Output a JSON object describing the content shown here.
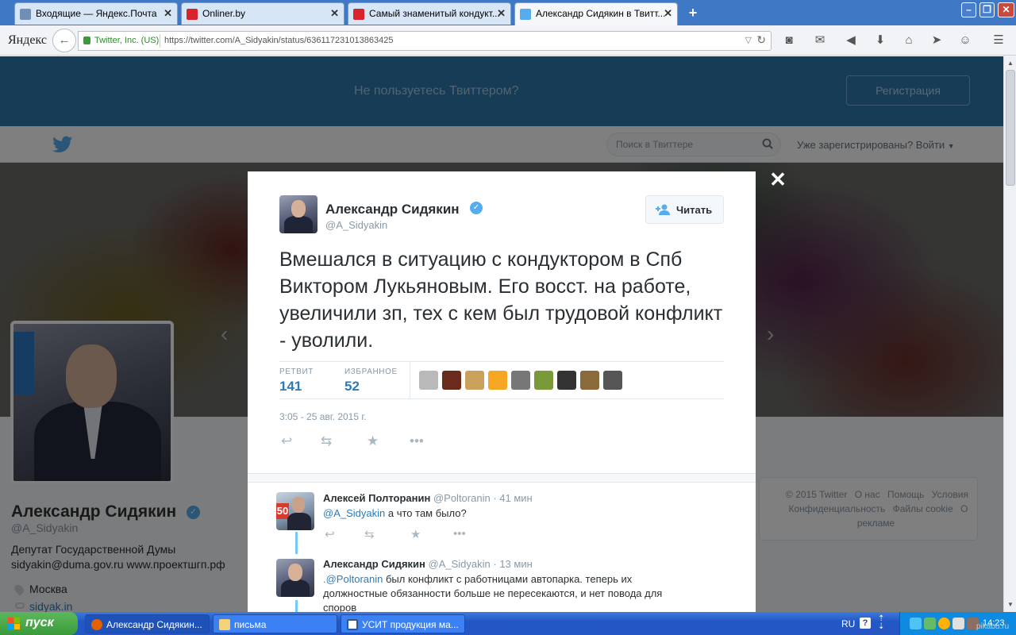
{
  "browser": {
    "tabs": [
      {
        "title": "Входящие — Яндекс.Почта",
        "close": "✕"
      },
      {
        "title": "Onliner.by",
        "close": "✕"
      },
      {
        "title": "Самый знаменитый кондукт...",
        "close": "✕"
      },
      {
        "title": "Александр Сидякин в Твитт...",
        "close": "✕"
      }
    ],
    "new_tab": "+",
    "logo": "Яндекс",
    "site_identity": "Twitter, Inc. (US)",
    "url": "https://twitter.com/A_Sidyakin/status/636117231013863425"
  },
  "page": {
    "banner": {
      "question": "Не пользуетесь Твиттером?",
      "register": "Регистрация"
    },
    "nav": {
      "search_placeholder": "Поиск в Твиттере",
      "login": "Уже зарегистрированы? Войти"
    },
    "profile": {
      "name": "Александр Сидякин",
      "handle": "@A_Sidyakin",
      "bio_line1": "Депутат Государственной Думы",
      "bio_line2": "sidyakin@duma.gov.ru www.проектшгп.рф",
      "location": "Москва",
      "website": "sidyak.in"
    },
    "footer": {
      "links": [
        "© 2015 Twitter",
        "О нас",
        "Помощь",
        "Условия",
        "Конфиденциальность",
        "Файлы cookie",
        "О рекламе"
      ]
    }
  },
  "tweet": {
    "author_name": "Александр Сидякин",
    "author_handle": "@A_Sidyakin",
    "follow_label": "Читать",
    "text": "Вмешался в ситуацию с кондуктором в Спб Виктором Лукьяновым. Его восст. на работе, увеличили зп, тех с кем был трудовой конфликт - уволили.",
    "retweets_label": "РЕТВИТ",
    "retweets": "141",
    "favorites_label": "ИЗБРАННОЕ",
    "favorites": "52",
    "date": "3:05 - 25 авг. 2015 г.",
    "face_colors": [
      "#b9b9b9",
      "#6b2a1c",
      "#c9a15a",
      "#f5a623",
      "#777777",
      "#7a9a3a",
      "#333333",
      "#8a6a3a",
      "#555555"
    ]
  },
  "replies": [
    {
      "name": "Алексей Полторанин",
      "handle": "@Poltoranin",
      "time": "· 41 мин",
      "mention": "@A_Sidyakin",
      "text": "а что там было?"
    },
    {
      "name": "Александр Сидякин",
      "handle": "@A_Sidyakin",
      "time": "· 13 мин",
      "mention": ".@Poltoranin",
      "text_line1": "был конфликт с работницами автопарка. теперь их",
      "text_line2": "должностные обязанности больше не пересекаются, и нет повода для",
      "text_line3": "споров"
    }
  ],
  "taskbar": {
    "start": "пуск",
    "tasks": [
      "Александр Сидякин...",
      "письма",
      "УСИТ продукция ма..."
    ],
    "lang": "RU",
    "clock": "14:23"
  },
  "watermark": "pikabu.ru"
}
